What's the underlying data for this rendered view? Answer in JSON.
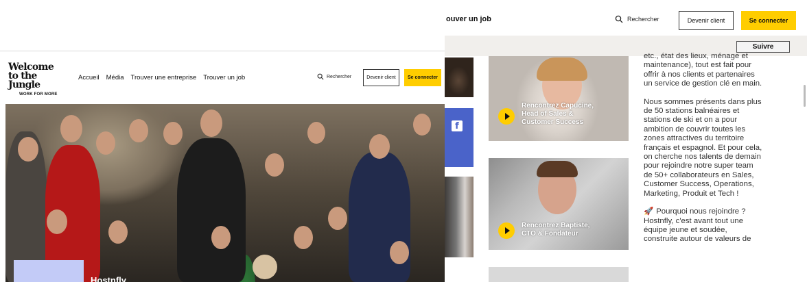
{
  "left": {
    "logo": {
      "line1": "Welcome",
      "line2": "to the Jungle",
      "tagline": "WORK FOR MORE"
    },
    "nav": [
      "Accueil",
      "Média",
      "Trouver une entreprise",
      "Trouver un job"
    ],
    "search_label": "Rechercher",
    "client_button": "Devenir client",
    "connect_button": "Se connecter",
    "hero_caption": "Hostnfly"
  },
  "right": {
    "nav_partial": "ouver un job",
    "search_label": "Rechercher",
    "client_button": "Devenir client",
    "connect_button": "Se connecter",
    "follow_button": "Suivre",
    "videos": [
      {
        "title": "Rencontrez Capucine,\nHead of Sales &\nCustomer Success"
      },
      {
        "title": "Rencontrez Baptiste,\nCTO & Fondateur"
      }
    ],
    "article": [
      "etc., état des lieux, ménage et\nmaintenance), tout est fait pour\noffrir à nos clients et partenaires\nun service de gestion clé en main.",
      "Nous sommes présents dans plus\nde 50 stations balnéaires et\nstations de ski et on a pour\nambition de couvrir toutes les\nzones attractives du territoire\nfrançais et espagnol. Et pour cela,\non cherche nos talents de demain\npour rejoindre notre super team\nde 50+ collaborateurs en Sales,\nCustomer Success, Operations,\nMarketing, Produit et Tech !",
      "Pourquoi nous rejoindre ?\nHostnfly, c'est avant tout une\néquipe jeune et soudée,\nconstruite autour de valeurs de"
    ]
  },
  "colors": {
    "accent_yellow": "#ffcd00",
    "facebook_blue": "#4a63c9",
    "card_lilac": "#c3cbf7"
  }
}
